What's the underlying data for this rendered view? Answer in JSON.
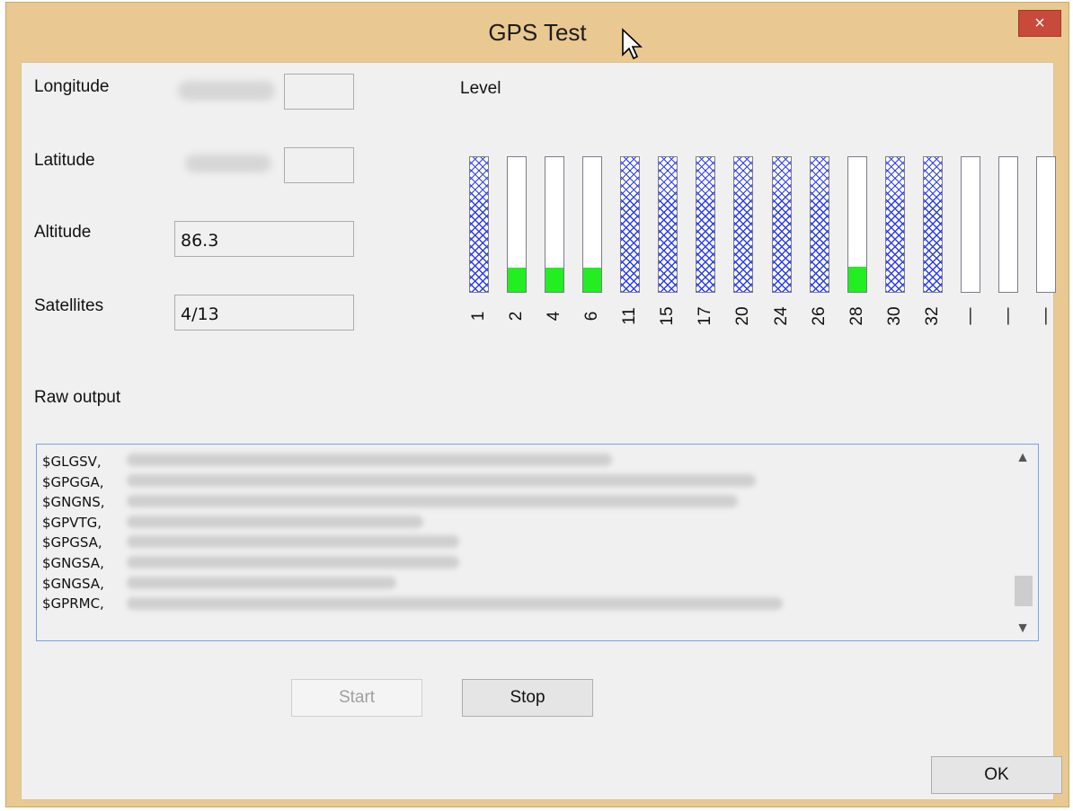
{
  "window": {
    "title": "GPS Test",
    "close_label": "×"
  },
  "fields": {
    "longitude_label": "Longitude",
    "latitude_label": "Latitude",
    "altitude_label": "Altitude",
    "altitude_value": "86.3",
    "satellites_label": "Satellites",
    "satellites_value": "4/13"
  },
  "level": {
    "label": "Level",
    "bars": [
      {
        "id": "1",
        "pattern": "hatched",
        "signal": 0
      },
      {
        "id": "2",
        "pattern": "none",
        "signal": 0.18
      },
      {
        "id": "4",
        "pattern": "none",
        "signal": 0.18
      },
      {
        "id": "6",
        "pattern": "none",
        "signal": 0.18
      },
      {
        "id": "11",
        "pattern": "hatched",
        "signal": 0
      },
      {
        "id": "15",
        "pattern": "hatched",
        "signal": 0
      },
      {
        "id": "17",
        "pattern": "hatched",
        "signal": 0
      },
      {
        "id": "20",
        "pattern": "hatched",
        "signal": 0
      },
      {
        "id": "24",
        "pattern": "hatched",
        "signal": 0
      },
      {
        "id": "26",
        "pattern": "hatched",
        "signal": 0
      },
      {
        "id": "28",
        "pattern": "none",
        "signal": 0.19
      },
      {
        "id": "30",
        "pattern": "hatched",
        "signal": 0
      },
      {
        "id": "32",
        "pattern": "hatched",
        "signal": 0
      },
      {
        "id": "—",
        "pattern": "none",
        "signal": 0
      },
      {
        "id": "—",
        "pattern": "none",
        "signal": 0
      },
      {
        "id": "—",
        "pattern": "none",
        "signal": 0
      }
    ],
    "colors": {
      "hatch": "#2a3cf0",
      "signal": "#22ee22"
    }
  },
  "raw": {
    "label": "Raw output",
    "lines": [
      "$GLGSV,",
      "$GPGGA,",
      "$GNGNS,",
      "$GPVTG,",
      "$GPGSA,",
      "$GNGSA,",
      "$GNGSA,",
      "$GPRMC,"
    ]
  },
  "buttons": {
    "start": "Start",
    "stop": "Stop",
    "ok": "OK"
  }
}
